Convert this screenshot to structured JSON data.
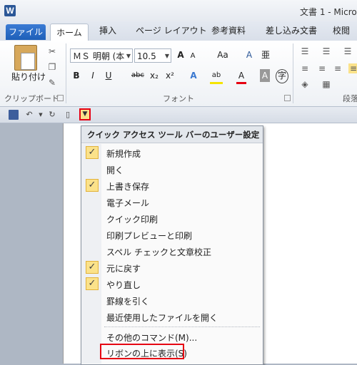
{
  "window": {
    "title": "文書 1 - Micro",
    "app_icon": "W"
  },
  "tabs": [
    {
      "label": "ファイル"
    },
    {
      "label": "ホーム"
    },
    {
      "label": "挿入"
    },
    {
      "label": "ページ レイアウト"
    },
    {
      "label": "参考資料"
    },
    {
      "label": "差し込み文書"
    },
    {
      "label": "校閲"
    }
  ],
  "ribbon": {
    "clipboard": {
      "paste_label": "貼り付け",
      "group_label": "クリップボード"
    },
    "font": {
      "font_name": "ＭＳ 明朝 (本",
      "font_size": "10.5",
      "group_label": "フォント",
      "bold": "B",
      "italic": "I",
      "underline": "U",
      "strike": "abc",
      "subscript": "x₂",
      "superscript": "x²",
      "grow": "A",
      "shrink": "A",
      "case": "Aa",
      "clear": "A",
      "text_effect": "A",
      "highlight": "ab",
      "font_color": "A",
      "char_border": "A",
      "enclose": "字",
      "phonetic": "亜"
    },
    "paragraph": {
      "group_label": "段落"
    }
  },
  "menu": {
    "header": "クイック アクセス ツール バーのユーザー設定",
    "items": [
      {
        "label": "新規作成",
        "checked": "✓"
      },
      {
        "label": "開く",
        "checked": ""
      },
      {
        "label": "上書き保存",
        "checked": "✓"
      },
      {
        "label": "電子メール",
        "checked": ""
      },
      {
        "label": "クイック印刷",
        "checked": ""
      },
      {
        "label": "印刷プレビューと印刷",
        "checked": ""
      },
      {
        "label": "スペル チェックと文章校正",
        "checked": ""
      },
      {
        "label": "元に戻す",
        "checked": "✓"
      },
      {
        "label": "やり直し",
        "checked": "✓"
      },
      {
        "label": "罫線を引く",
        "checked": ""
      },
      {
        "label": "最近使用したファイルを開く",
        "checked": ""
      }
    ],
    "more_commands": "その他のコマンド(M)...",
    "show_above": "リボンの上に表示(S)"
  }
}
